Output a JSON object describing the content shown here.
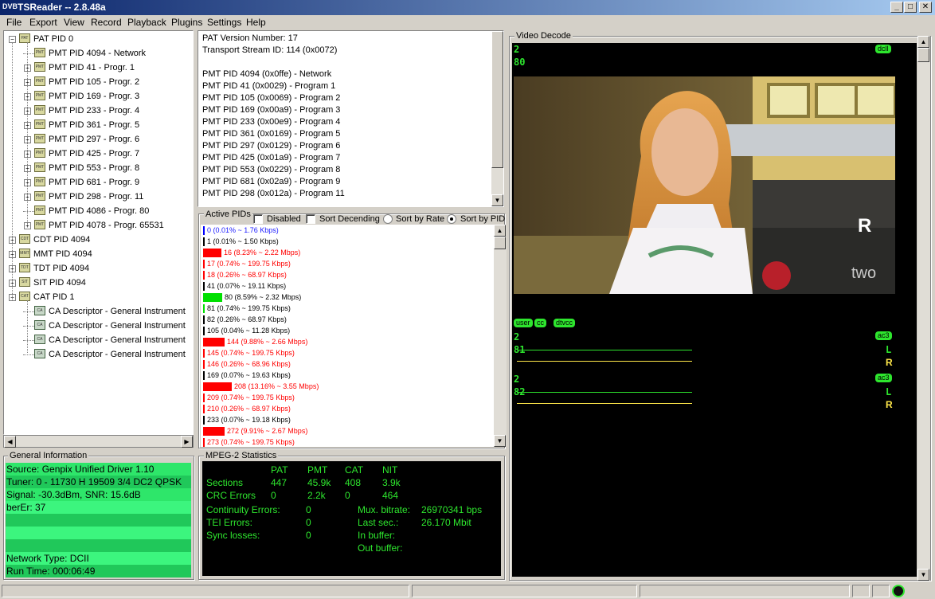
{
  "window": {
    "icon_text": "DVB",
    "title": "TSReader -- 2.8.48a",
    "min": "_",
    "max": "□",
    "close": "✕"
  },
  "menu": [
    "File",
    "Export",
    "View",
    "Record",
    "Playback",
    "Plugins",
    "Settings",
    "Help"
  ],
  "tree": [
    {
      "label": "PAT PID 0",
      "icon": "PAT",
      "expander": "−"
    },
    {
      "label": "PMT PID 4094 - Network",
      "icon": "PMT"
    },
    {
      "label": "PMT PID 41 - Progr. 1",
      "icon": "PMT",
      "expander": "+"
    },
    {
      "label": "PMT PID 105 - Progr. 2",
      "icon": "PMT",
      "expander": "+"
    },
    {
      "label": "PMT PID 169 - Progr. 3",
      "icon": "PMT",
      "expander": "+"
    },
    {
      "label": "PMT PID 233 - Progr. 4",
      "icon": "PMT",
      "expander": "+"
    },
    {
      "label": "PMT PID 361 - Progr. 5",
      "icon": "PMT",
      "expander": "+"
    },
    {
      "label": "PMT PID 297 - Progr. 6",
      "icon": "PMT",
      "expander": "+"
    },
    {
      "label": "PMT PID 425 - Progr. 7",
      "icon": "PMT",
      "expander": "+"
    },
    {
      "label": "PMT PID 553 - Progr. 8",
      "icon": "PMT",
      "expander": "+"
    },
    {
      "label": "PMT PID 681 - Progr. 9",
      "icon": "PMT",
      "expander": "+"
    },
    {
      "label": "PMT PID 298 - Progr. 11",
      "icon": "PMT",
      "expander": "+"
    },
    {
      "label": "PMT PID 4086 - Progr. 80",
      "icon": "PMT"
    },
    {
      "label": "PMT PID 4078 - Progr. 65531",
      "icon": "PMT",
      "expander": "+"
    },
    {
      "label": "CDT PID 4094",
      "icon": "CDT",
      "expander": "+"
    },
    {
      "label": "MMT PID 4094",
      "icon": "MMT",
      "expander": "+"
    },
    {
      "label": "TDT PID 4094",
      "icon": "TDT",
      "expander": "+"
    },
    {
      "label": "SIT PID 4094",
      "icon": "SIT",
      "expander": "+"
    },
    {
      "label": "CAT PID 1",
      "icon": "CAT",
      "expander": "−"
    },
    {
      "label": "CA Descriptor - General Instrument",
      "icon": "CA"
    },
    {
      "label": "CA Descriptor - General Instrument",
      "icon": "CA"
    },
    {
      "label": "CA Descriptor - General Instrument",
      "icon": "CA"
    },
    {
      "label": "CA Descriptor - General Instrument",
      "icon": "CA"
    }
  ],
  "info_lines": [
    "PAT Version Number: 17",
    "Transport Stream ID: 114 (0x0072)",
    "",
    "PMT PID 4094 (0x0ffe) - Network",
    "PMT PID 41 (0x0029) - Program 1",
    "PMT PID 105 (0x0069) - Program 2",
    "PMT PID 169 (0x00a9) - Program 3",
    "PMT PID 233 (0x00e9) - Program 4",
    "PMT PID 361 (0x0169) - Program 5",
    "PMT PID 297 (0x0129) - Program 6",
    "PMT PID 425 (0x01a9) - Program 7",
    "PMT PID 553 (0x0229) - Program 8",
    "PMT PID 681 (0x02a9) - Program 9",
    "PMT PID 298 (0x012a) - Program 11"
  ],
  "active_pids": {
    "title": "Active PIDs",
    "options": {
      "disabled": "Disabled",
      "sort_desc": "Sort Decending",
      "sort_rate": "Sort by Rate",
      "sort_pid": "Sort by PID"
    },
    "rows": [
      {
        "text": "0 (0.01% ~ 1.76 Kbps)",
        "pct": 0.01,
        "color": "#1a1aff",
        "bar": "#0000ff"
      },
      {
        "text": "1 (0.01% ~ 1.50 Kbps)",
        "pct": 0.01,
        "color": "#000000",
        "bar": "#000000"
      },
      {
        "text": "16 (8.23% ~ 2.22 Mbps)",
        "pct": 8.23,
        "color": "#ff0000",
        "bar": "#ff0000"
      },
      {
        "text": "17 (0.74% ~ 199.75 Kbps)",
        "pct": 0.74,
        "color": "#ff0000",
        "bar": "#ff0000"
      },
      {
        "text": "18 (0.26% ~ 68.97 Kbps)",
        "pct": 0.26,
        "color": "#ff0000",
        "bar": "#ff0000"
      },
      {
        "text": "41 (0.07% ~ 19.11 Kbps)",
        "pct": 0.07,
        "color": "#000000",
        "bar": "#000000"
      },
      {
        "text": "80 (8.59% ~ 2.32 Mbps)",
        "pct": 8.59,
        "color": "#000000",
        "bar": "#00e000"
      },
      {
        "text": "81 (0.74% ~ 199.75 Kbps)",
        "pct": 0.74,
        "color": "#000000",
        "bar": "#00e000"
      },
      {
        "text": "82 (0.26% ~ 68.97 Kbps)",
        "pct": 0.26,
        "color": "#000000",
        "bar": "#000000"
      },
      {
        "text": "105 (0.04% ~ 11.28 Kbps)",
        "pct": 0.04,
        "color": "#000000",
        "bar": "#000000"
      },
      {
        "text": "144 (9.88% ~ 2.66 Mbps)",
        "pct": 9.88,
        "color": "#ff0000",
        "bar": "#ff0000"
      },
      {
        "text": "145 (0.74% ~ 199.75 Kbps)",
        "pct": 0.74,
        "color": "#ff0000",
        "bar": "#ff0000"
      },
      {
        "text": "146 (0.26% ~ 68.96 Kbps)",
        "pct": 0.26,
        "color": "#ff0000",
        "bar": "#ff0000"
      },
      {
        "text": "169 (0.07% ~ 19.63 Kbps)",
        "pct": 0.07,
        "color": "#000000",
        "bar": "#000000"
      },
      {
        "text": "208 (13.16% ~ 3.55 Mbps)",
        "pct": 13.16,
        "color": "#ff0000",
        "bar": "#ff0000"
      },
      {
        "text": "209 (0.74% ~ 199.75 Kbps)",
        "pct": 0.74,
        "color": "#ff0000",
        "bar": "#ff0000"
      },
      {
        "text": "210 (0.26% ~ 68.97 Kbps)",
        "pct": 0.26,
        "color": "#ff0000",
        "bar": "#ff0000"
      },
      {
        "text": "233 (0.07% ~ 19.18 Kbps)",
        "pct": 0.07,
        "color": "#000000",
        "bar": "#000000"
      },
      {
        "text": "272 (9.91% ~ 2.67 Mbps)",
        "pct": 9.91,
        "color": "#ff0000",
        "bar": "#ff0000"
      },
      {
        "text": "273 (0.74% ~ 199.75 Kbps)",
        "pct": 0.74,
        "color": "#ff0000",
        "bar": "#ff0000"
      }
    ]
  },
  "general_info": {
    "title": "General Information",
    "rows": [
      {
        "text": "Source: Genpix Unified Driver 1.10",
        "bg": "#2ee66a"
      },
      {
        "text": "Tuner: 0 - 11730 H 19509 3/4 DC2 QPSK",
        "bg": "#20c85a"
      },
      {
        "text": "Signal: -30.3dBm, SNR: 15.6dB",
        "bg": "#2ee66a"
      },
      {
        "text": "berEr: 37",
        "bg": "#3cf57e"
      },
      {
        "text": "",
        "bg": "#20c85a"
      },
      {
        "text": "",
        "bg": "#3cf57e"
      },
      {
        "text": "",
        "bg": "#20c85a"
      },
      {
        "text": "Network Type: DCII",
        "bg": "#3cf57e"
      },
      {
        "text": "Run Time: 000:06:49",
        "bg": "#20c85a"
      }
    ]
  },
  "mpeg_stats": {
    "title": "MPEG-2 Statistics",
    "headers": [
      "PAT",
      "PMT",
      "CAT",
      "NIT"
    ],
    "sections_label": "Sections",
    "sections": [
      "447",
      "45.9k",
      "408",
      "3.9k"
    ],
    "crc_label": "CRC Errors",
    "crc": [
      "0",
      "2.2k",
      "0",
      "464"
    ],
    "continuity_label": "Continuity Errors:",
    "continuity": "0",
    "tei_label": "TEI Errors:",
    "tei": "0",
    "sync_label": "Sync losses:",
    "sync": "0",
    "mux_label": "Mux. bitrate:",
    "mux": "26970341 bps",
    "last_label": "Last sec.:",
    "last": "26.170 Mbit",
    "inbuf_label": "In buffer:",
    "outbuf_label": "Out buffer:"
  },
  "video_decode": {
    "title": "Video Decode",
    "video_line1": "2",
    "video_line2": "80",
    "video_tag": "dcll",
    "watermark": "two",
    "sign_text": "R",
    "tags": [
      "user",
      "cc",
      "dtvcc"
    ],
    "audio": [
      {
        "line1": "2",
        "line2": "81",
        "tag": "ac3",
        "left": "L",
        "right": "R"
      },
      {
        "line1": "2",
        "line2": "82",
        "tag": "ac3",
        "left": "L",
        "right": "R"
      }
    ]
  },
  "colors": {
    "green_text": "#2ee62e",
    "yellow_text": "#ffe84a",
    "title_start": "#0a246a",
    "title_end": "#a6caf0"
  }
}
